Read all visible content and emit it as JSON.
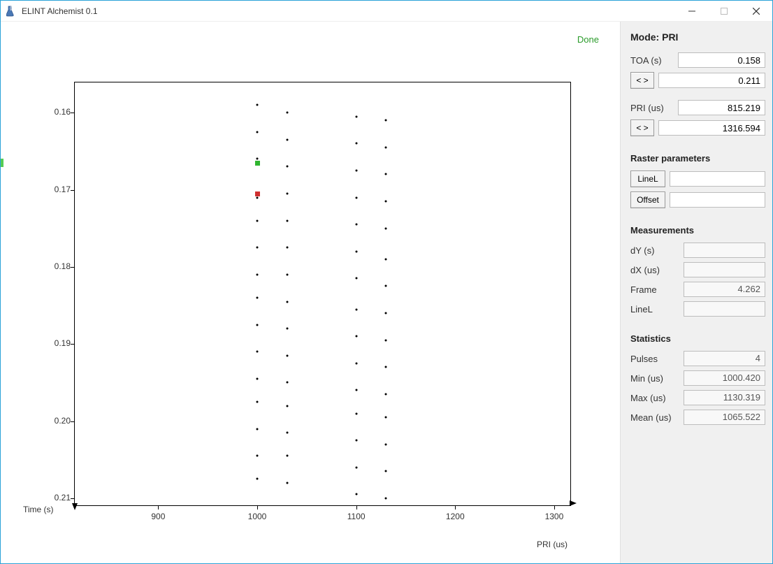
{
  "window": {
    "title": "ELINT Alchemist 0.1"
  },
  "status": "Done",
  "mode": {
    "heading": "Mode: PRI"
  },
  "toa": {
    "label": "TOA (s)",
    "val1": "0.158",
    "val2": "0.211",
    "navBtn": "< >"
  },
  "pri": {
    "label": "PRI (us)",
    "val1": "815.219",
    "val2": "1316.594",
    "navBtn": "< >"
  },
  "raster": {
    "heading": "Raster parameters",
    "linelBtn": "LineL",
    "offsetBtn": "Offset",
    "linelVal": "",
    "offsetVal": ""
  },
  "meas": {
    "heading": "Measurements",
    "dyLabel": "dY (s)",
    "dxLabel": "dX (us)",
    "frameLabel": "Frame",
    "linelLabel": "LineL",
    "dyVal": "",
    "dxVal": "",
    "frameVal": "4.262",
    "linelVal": ""
  },
  "stats": {
    "heading": "Statistics",
    "pulsesLabel": "Pulses",
    "minLabel": "Min (us)",
    "maxLabel": "Max (us)",
    "meanLabel": "Mean (us)",
    "pulsesVal": "4",
    "minVal": "1000.420",
    "maxVal": "1130.319",
    "meanVal": "1065.522"
  },
  "chart_data": {
    "type": "scatter",
    "xlabel": "PRI (us)",
    "ylabel": "Time (s)",
    "xlim": [
      815,
      1317
    ],
    "ylim": [
      0.211,
      0.156
    ],
    "xticks": [
      900,
      1000,
      1100,
      1200,
      1300
    ],
    "yticks": [
      0.16,
      0.17,
      0.18,
      0.19,
      0.2,
      0.21
    ],
    "markers": [
      {
        "x": 1000,
        "y": 0.1665,
        "color": "#2fb52f",
        "name": "green-marker"
      },
      {
        "x": 1000,
        "y": 0.1705,
        "color": "#cf2f2f",
        "name": "red-marker"
      }
    ],
    "series": [
      {
        "name": "col1",
        "x": 1000,
        "y": [
          0.159,
          0.1625,
          0.166,
          0.171,
          0.174,
          0.1775,
          0.181,
          0.184,
          0.1875,
          0.191,
          0.1945,
          0.1975,
          0.201,
          0.2045,
          0.2075
        ]
      },
      {
        "name": "col2",
        "x": 1030,
        "y": [
          0.16,
          0.1635,
          0.167,
          0.1705,
          0.174,
          0.1775,
          0.181,
          0.1845,
          0.188,
          0.1915,
          0.195,
          0.198,
          0.2015,
          0.2045,
          0.208
        ]
      },
      {
        "name": "col3",
        "x": 1100,
        "y": [
          0.1605,
          0.164,
          0.1675,
          0.171,
          0.1745,
          0.178,
          0.1815,
          0.1855,
          0.189,
          0.1925,
          0.196,
          0.199,
          0.2025,
          0.206,
          0.2095
        ]
      },
      {
        "name": "col4",
        "x": 1130,
        "y": [
          0.161,
          0.1645,
          0.168,
          0.1715,
          0.175,
          0.179,
          0.1825,
          0.186,
          0.1895,
          0.193,
          0.1965,
          0.1995,
          0.203,
          0.2065,
          0.21
        ]
      }
    ]
  }
}
